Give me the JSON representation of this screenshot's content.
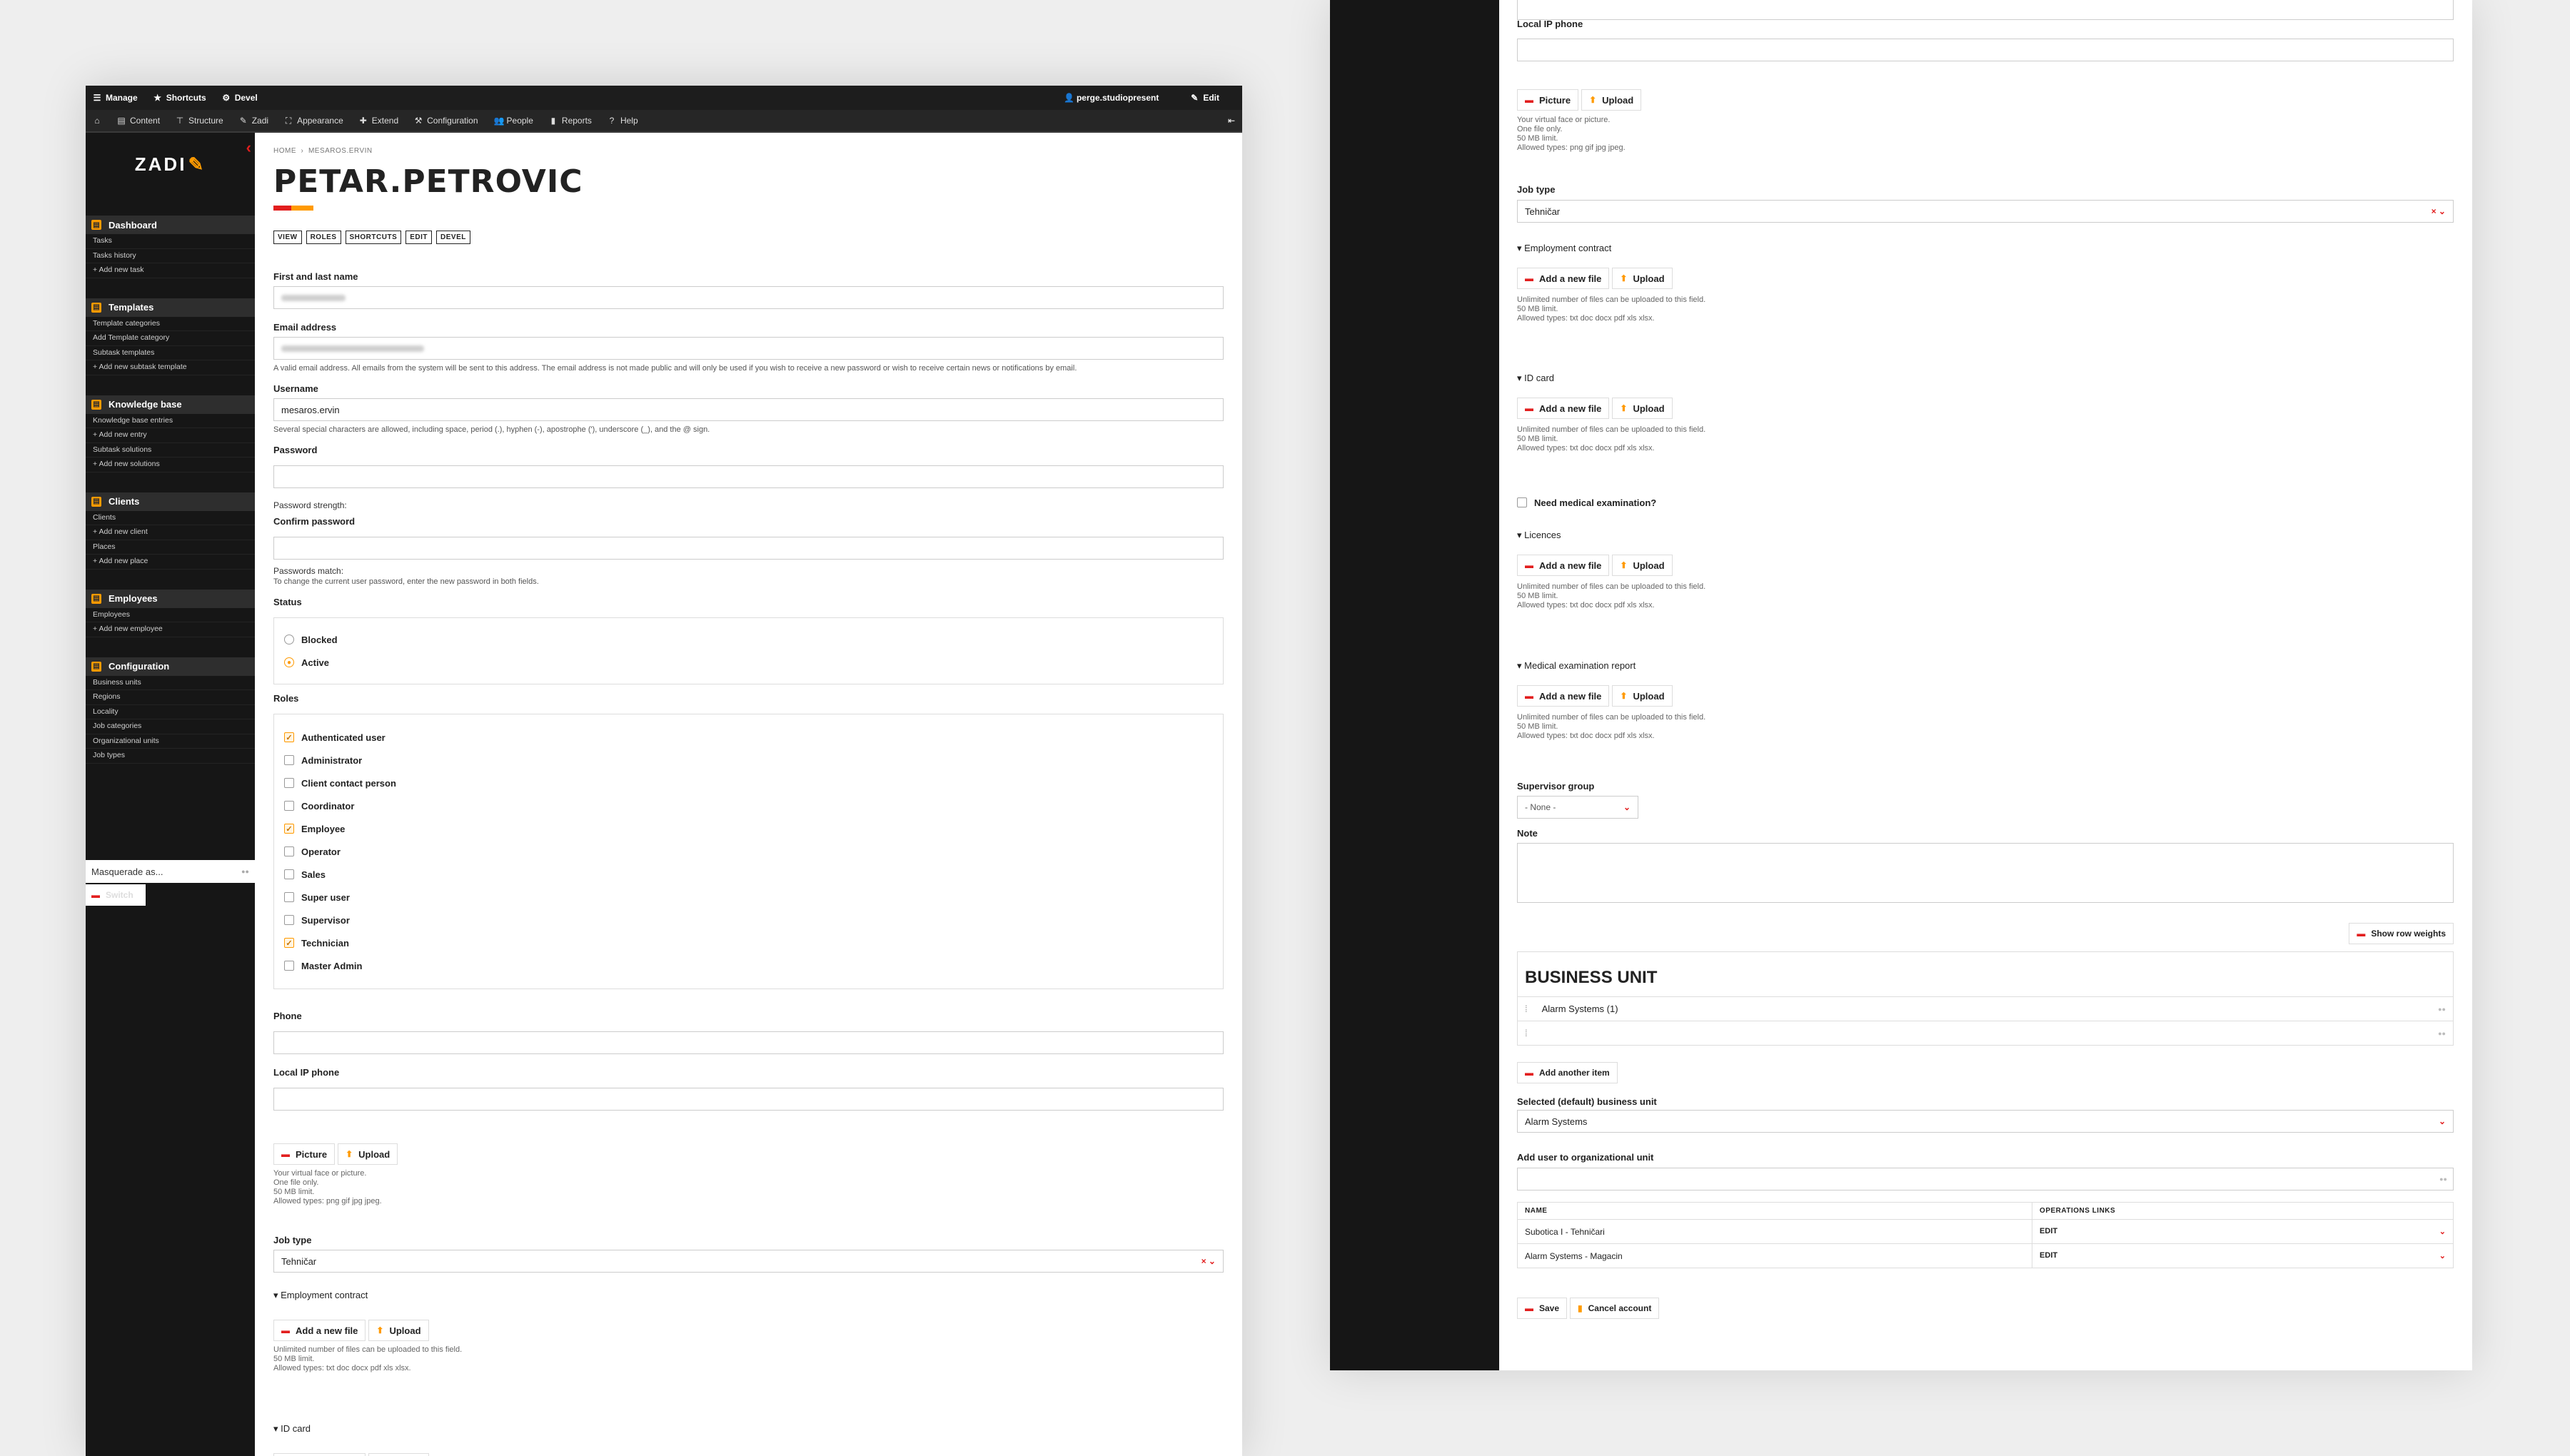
{
  "toolbar": {
    "manage": "Manage",
    "shortcuts": "Shortcuts",
    "devel": "Devel",
    "user": "perge.studiopresent",
    "edit": "Edit"
  },
  "admin_menu": [
    "Content",
    "Structure",
    "Zadi",
    "Appearance",
    "Extend",
    "Configuration",
    "People",
    "Reports",
    "Help"
  ],
  "logo": "ZADI",
  "sidebar": {
    "groups": [
      {
        "title": "Dashboard",
        "items": [
          "Tasks",
          "Tasks history",
          "+ Add new task"
        ]
      },
      {
        "title": "Templates",
        "items": [
          "Template categories",
          "Add Template category",
          "Subtask templates",
          "+ Add new subtask template"
        ]
      },
      {
        "title": "Knowledge base",
        "items": [
          "Knowledge base entries",
          "+ Add new entry",
          "Subtask solutions",
          "+ Add new solutions"
        ]
      },
      {
        "title": "Clients",
        "items": [
          "Clients",
          "+ Add new client",
          "Places",
          "+ Add new place"
        ]
      },
      {
        "title": "Employees",
        "items": [
          "Employees",
          "+ Add new employee"
        ]
      },
      {
        "title": "Configuration",
        "items": [
          "Business units",
          "Regions",
          "Locality",
          "Job categories",
          "Organizational units",
          "Job types"
        ]
      }
    ],
    "masquerade": "Masquerade as...",
    "switch": "Switch"
  },
  "page": {
    "breadcrumb": [
      "HOME",
      "MESAROS.ERVIN"
    ],
    "title": "PETAR.PETROVIC",
    "tabs": [
      "VIEW",
      "ROLES",
      "SHORTCUTS",
      "EDIT",
      "DEVEL"
    ]
  },
  "form": {
    "name_label": "First and last name",
    "email_label": "Email address",
    "email_desc": "A valid email address. All emails from the system will be sent to this address. The email address is not made public and will only be used if you wish to receive a new password or wish to receive certain news or notifications by email.",
    "username_label": "Username",
    "username_value": "mesaros.ervin",
    "username_desc": "Several special characters are allowed, including space, period (.), hyphen (-), apostrophe ('), underscore (_), and the @ sign.",
    "password_label": "Password",
    "strength_label": "Password strength:",
    "confirm_label": "Confirm password",
    "match_label": "Passwords match:",
    "change_desc": "To change the current user password, enter the new password in both fields.",
    "status_label": "Status",
    "status_options": [
      {
        "label": "Blocked",
        "checked": false
      },
      {
        "label": "Active",
        "checked": true
      }
    ],
    "roles_label": "Roles",
    "roles": [
      {
        "label": "Authenticated user",
        "checked": true
      },
      {
        "label": "Administrator",
        "checked": false
      },
      {
        "label": "Client contact person",
        "checked": false
      },
      {
        "label": "Coordinator",
        "checked": false
      },
      {
        "label": "Employee",
        "checked": true
      },
      {
        "label": "Operator",
        "checked": false
      },
      {
        "label": "Sales",
        "checked": false
      },
      {
        "label": "Super user",
        "checked": false
      },
      {
        "label": "Supervisor",
        "checked": false
      },
      {
        "label": "Technician",
        "checked": true
      },
      {
        "label": "Master Admin",
        "checked": false
      }
    ],
    "phone_label": "Phone",
    "ip_phone_label": "Local IP phone",
    "picture_button": "Picture",
    "upload_button": "Upload",
    "picture_desc": [
      "Your virtual face or picture.",
      "One file only.",
      "50 MB limit.",
      "Allowed types: png gif jpg jpeg."
    ],
    "job_type_label": "Job type",
    "job_type_value": "Tehničar",
    "employment_contract": "Employment contract",
    "add_new_file": "Add a new file",
    "file_desc": [
      "Unlimited number of files can be uploaded to this field.",
      "50 MB limit.",
      "Allowed types: txt doc docx pdf xls xlsx."
    ],
    "id_card": "ID card",
    "medical_check": "Need medical examination?",
    "licences": "Licences",
    "medical_report": "Medical examination report",
    "supervisor_group_label": "Supervisor group",
    "supervisor_group_value": "- None -",
    "note_label": "Note",
    "show_row_weights": "Show row weights",
    "business_unit_heading": "BUSINESS UNIT",
    "business_unit_item": "Alarm Systems (1)",
    "add_another_item": "Add another item",
    "default_bu_label": "Selected (default) business unit",
    "default_bu_value": "Alarm Systems",
    "org_unit_label": "Add user to organizational unit",
    "org_table": {
      "headers": [
        "NAME",
        "OPERATIONS LINKS"
      ],
      "rows": [
        {
          "name": "Subotica I - Tehničari",
          "op": "EDIT"
        },
        {
          "name": "Alarm Systems - Magacin",
          "op": "EDIT"
        }
      ]
    },
    "save_button": "Save",
    "cancel_account_button": "Cancel account"
  },
  "colors": {
    "accent_orange": "#ff9a00",
    "accent_red": "#e21e1e",
    "sidebar_bg": "#161616"
  }
}
